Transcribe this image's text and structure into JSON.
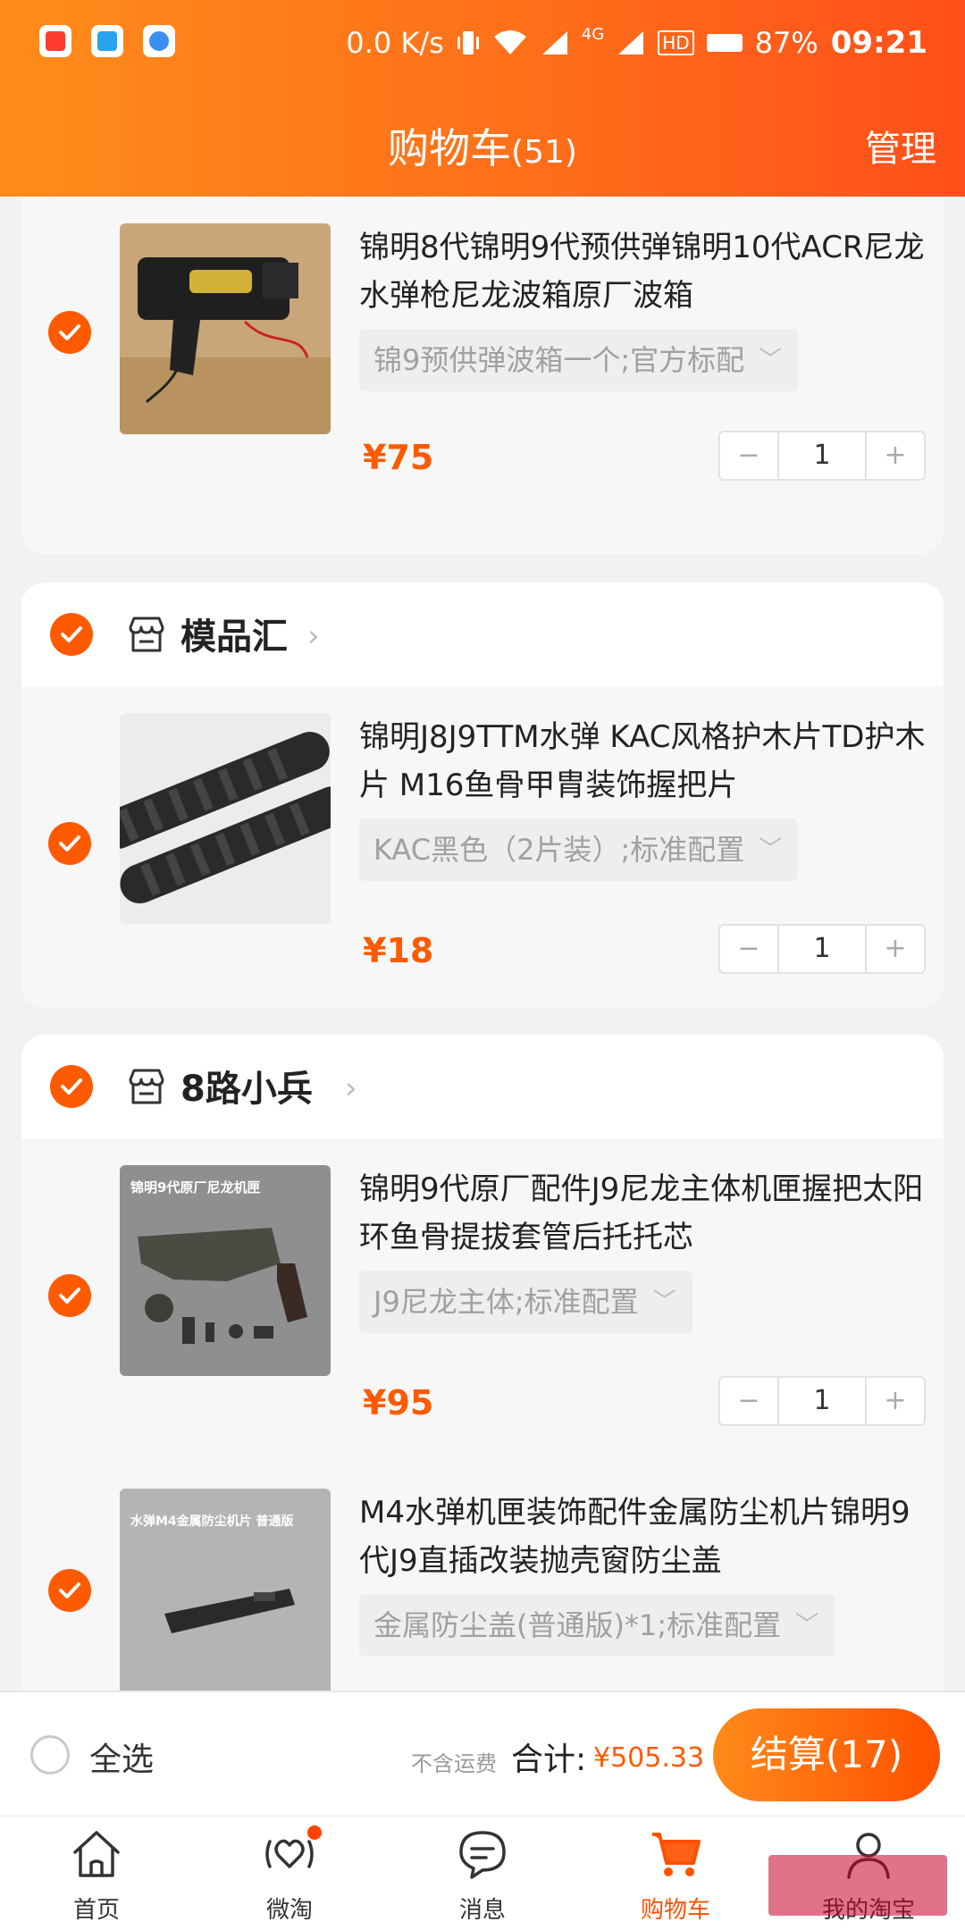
{
  "status_bar": {
    "net_speed": "0.0 K/s",
    "network": "4G",
    "hd": "HD",
    "battery": "87%",
    "time": "09:21"
  },
  "header": {
    "title": "购物车",
    "count": "(51)",
    "manage": "管理"
  },
  "items": [
    {
      "title": "锦明8代锦明9代预供弹锦明10代ACR尼龙水弹枪尼龙波箱原厂波箱",
      "sku": "锦9预供弹波箱一个;官方标配",
      "price": "¥75",
      "qty": "1"
    },
    {
      "title": "锦明J8J9TTM水弹 KAC风格护木片TD护木片 M16鱼骨甲胄装饰握把片",
      "sku": "KAC黑色（2片装）;标准配置",
      "price": "¥18",
      "qty": "1"
    },
    {
      "title": "锦明9代原厂配件J9尼龙主体机匣握把太阳环鱼骨提拔套管后托托芯",
      "sku": "J9尼龙主体;标准配置",
      "price": "¥95",
      "qty": "1"
    },
    {
      "title": "M4水弹机匣装饰配件金属防尘机片锦明9代J9直插改装抛壳窗防尘盖",
      "sku": "金属防尘盖(普通版)*1;标准配置",
      "price": "",
      "qty": ""
    }
  ],
  "shops": [
    {
      "name": "模品汇"
    },
    {
      "name": "8路小兵"
    }
  ],
  "thumb_text": {
    "item3": "锦明9代原厂尼龙机匣",
    "item4": "水弹M4金属防尘机片 普通版"
  },
  "stepper": {
    "minus": "−",
    "plus": "+"
  },
  "checkout": {
    "select_all": "全选",
    "no_shipping": "不含运费",
    "total_label": "合计:",
    "total_value": "¥505.33",
    "button": "结算(17)"
  },
  "tabs": [
    {
      "label": "首页",
      "icon": "home-icon"
    },
    {
      "label": "微淘",
      "icon": "heart-wave-icon"
    },
    {
      "label": "消息",
      "icon": "chat-bubble-icon"
    },
    {
      "label": "购物车",
      "icon": "cart-icon"
    },
    {
      "label": "我的淘宝",
      "icon": "profile-icon"
    }
  ],
  "colors": {
    "accent": "#ff5a00",
    "header_start": "#ff8c1a",
    "header_end": "#ff4f1a"
  }
}
